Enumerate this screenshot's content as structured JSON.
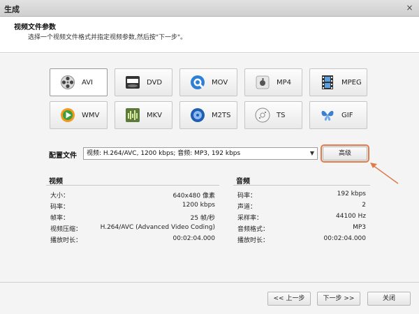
{
  "window": {
    "title": "生成",
    "close_glyph": "×"
  },
  "header": {
    "title": "视频文件参数",
    "subtitle": "选择一个视频文件格式并指定视频参数,然后按\"下一步\"。"
  },
  "formats": [
    {
      "label": "AVI",
      "icon": "avi-film-reel-icon",
      "selected": true
    },
    {
      "label": "DVD",
      "icon": "dvd-disc-icon",
      "selected": false
    },
    {
      "label": "MOV",
      "icon": "quicktime-icon",
      "selected": false
    },
    {
      "label": "MP4",
      "icon": "apple-device-icon",
      "selected": false
    },
    {
      "label": "MPEG",
      "icon": "film-strip-icon",
      "selected": false
    },
    {
      "label": "WMV",
      "icon": "windows-media-icon",
      "selected": false
    },
    {
      "label": "MKV",
      "icon": "mkv-waveform-icon",
      "selected": false
    },
    {
      "label": "M2TS",
      "icon": "bluray-icon",
      "selected": false
    },
    {
      "label": "TS",
      "icon": "ts-disc-icon",
      "selected": false
    },
    {
      "label": "GIF",
      "icon": "gif-butterfly-icon",
      "selected": false
    }
  ],
  "profile": {
    "label": "配置文件",
    "value": "视频: H.264/AVC, 1200 kbps; 音频: MP3, 192 kbps",
    "advanced_label": "高级"
  },
  "video": {
    "heading": "视频",
    "rows": [
      {
        "k": "大小：",
        "v": "640x480 像素"
      },
      {
        "k": "码率：",
        "v": "1200 kbps"
      },
      {
        "k": "帧率：",
        "v": "25 帧/秒"
      },
      {
        "k": "视频压缩：",
        "v": "H.264/AVC (Advanced Video Coding)"
      },
      {
        "k": "播放时长：",
        "v": "00:02:04.000"
      }
    ]
  },
  "audio": {
    "heading": "音频",
    "rows": [
      {
        "k": "码率：",
        "v": "192 kbps"
      },
      {
        "k": "声道：",
        "v": "2"
      },
      {
        "k": "采样率：",
        "v": "44100 Hz"
      },
      {
        "k": "音频格式：",
        "v": "MP3"
      },
      {
        "k": "播放时长：",
        "v": "00:02:04.000"
      }
    ]
  },
  "footer": {
    "back_label": "<< 上一步",
    "next_label": "下一步 >>",
    "close_label": "关闭"
  },
  "colors": {
    "highlight": "#e07a4a",
    "background": "#f4f4f4"
  }
}
